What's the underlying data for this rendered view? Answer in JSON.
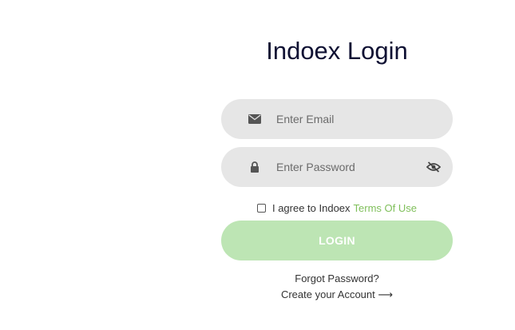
{
  "login": {
    "title": "Indoex Login",
    "email": {
      "placeholder": "Enter Email",
      "value": "",
      "icon": "envelope-icon"
    },
    "password": {
      "placeholder": "Enter Password",
      "value": "",
      "icon": "lock-icon",
      "toggle_icon": "eye-slash-icon"
    },
    "terms": {
      "checked": false,
      "text": "I agree to Indoex",
      "link_label": "Terms Of Use"
    },
    "login_button_label": "LOGIN",
    "forgot_password_label": "Forgot Password?",
    "create_account_label": "Create your Account",
    "create_account_arrow": "⟶"
  },
  "colors": {
    "title_text": "#0f1133",
    "field_background": "#e6e6e6",
    "terms_link": "#7fbf5a",
    "login_button_background": "#bde5b4",
    "login_button_text": "#ffffff"
  }
}
